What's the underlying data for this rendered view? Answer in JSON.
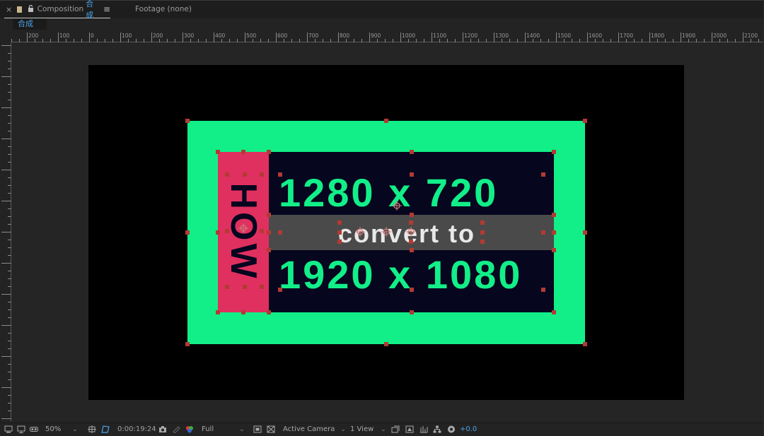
{
  "tabs": {
    "close_icon": "×",
    "composition_label": "Composition",
    "composition_name": "合成",
    "menu_icon": "≡",
    "footage_label": "Footage (none)"
  },
  "subtab": {
    "name": "合成"
  },
  "ruler": {
    "labels": [
      "200",
      "100",
      "0",
      "100",
      "200",
      "300",
      "400",
      "500",
      "600",
      "700",
      "800",
      "900",
      "1000",
      "1100",
      "1200",
      "1300",
      "1400",
      "1500",
      "1600",
      "1700",
      "1800",
      "1900",
      "2000",
      "2100"
    ]
  },
  "content": {
    "how": "HOW",
    "line1": "1280 x 720",
    "line2": "convert to",
    "line3": "1920 x 1080"
  },
  "toolbar": {
    "zoom": "50%",
    "timecode": "0:00:19:24",
    "resolution": "Full",
    "camera": "Active Camera",
    "views": "1 View",
    "exposure": "+0.0"
  },
  "colors": {
    "accent": "#4aa3e8",
    "green": "#12ef88",
    "pink": "#e0305f",
    "navy": "#06061f",
    "handle": "#b33a33"
  }
}
